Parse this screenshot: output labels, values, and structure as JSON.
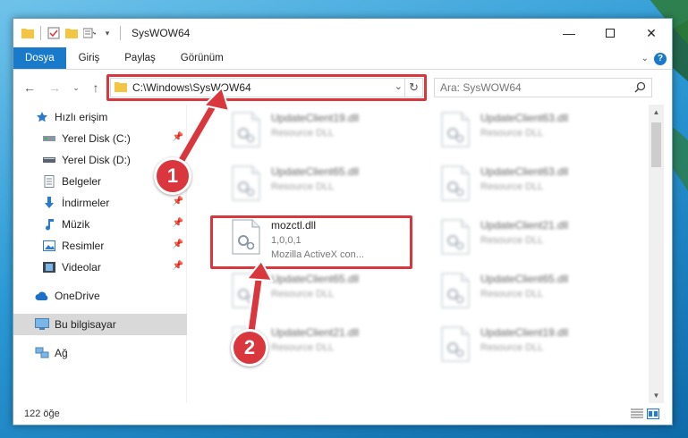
{
  "window": {
    "title": "SysWOW64"
  },
  "ribbon": {
    "tabs": [
      "Dosya",
      "Giriş",
      "Paylaş",
      "Görünüm"
    ]
  },
  "address": {
    "path": "C:\\Windows\\SysWOW64"
  },
  "search": {
    "placeholder": "Ara: SysWOW64"
  },
  "sidebar": {
    "items": [
      {
        "label": "Hızlı erişim",
        "icon": "star-icon"
      },
      {
        "label": "Yerel Disk (C:)",
        "icon": "drive-icon",
        "pinned": true
      },
      {
        "label": "Yerel Disk (D:)",
        "icon": "drive-icon"
      },
      {
        "label": "Belgeler",
        "icon": "documents-icon",
        "pinned": true
      },
      {
        "label": "İndirmeler",
        "icon": "download-icon",
        "pinned": true
      },
      {
        "label": "Müzik",
        "icon": "music-icon",
        "pinned": true
      },
      {
        "label": "Resimler",
        "icon": "pictures-icon",
        "pinned": true
      },
      {
        "label": "Videolar",
        "icon": "videos-icon",
        "pinned": true
      },
      {
        "label": "OneDrive",
        "icon": "cloud-icon"
      },
      {
        "label": "Bu bilgisayar",
        "icon": "computer-icon",
        "selected": true
      },
      {
        "label": "Ağ",
        "icon": "network-icon"
      }
    ]
  },
  "files": [
    {
      "name": "UpdateClient19.dll",
      "desc": "Resource DLL",
      "blurred": true
    },
    {
      "name": "UpdateClient63.dll",
      "desc": "Resource DLL",
      "blurred": true
    },
    {
      "name": "UpdateClient65.dll",
      "desc": "Resource DLL",
      "blurred": true
    },
    {
      "name": "UpdateClient63.dll",
      "desc": "Resource DLL",
      "blurred": true
    },
    {
      "name": "mozctl.dll",
      "version": "1,0,0,1",
      "desc": "Mozilla ActiveX con...",
      "blurred": false
    },
    {
      "name": "UpdateClient21.dll",
      "desc": "Resource DLL",
      "blurred": true
    },
    {
      "name": "UpdateClient65.dll",
      "desc": "Resource DLL",
      "blurred": true
    },
    {
      "name": "UpdateClient65.dll",
      "desc": "Resource DLL",
      "blurred": true
    },
    {
      "name": "UpdateClient21.dll",
      "desc": "Resource DLL",
      "blurred": true
    },
    {
      "name": "UpdateClient19.dll",
      "desc": "Resource DLL",
      "blurred": true
    }
  ],
  "status": {
    "count": "122 öğe"
  },
  "annotations": {
    "step1": "1",
    "step2": "2",
    "color": "#d9363e"
  }
}
